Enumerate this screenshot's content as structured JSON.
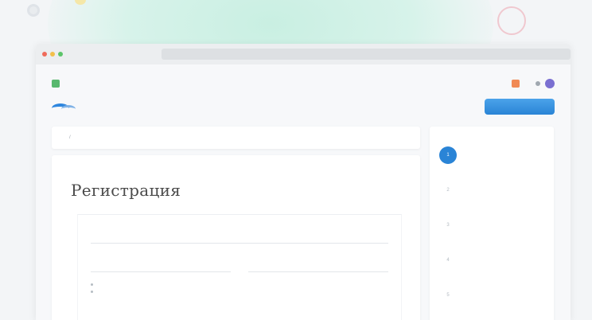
{
  "colors": {
    "accent": "#2a84d6",
    "mint": "#c9efe2",
    "active_step": "#2a84d6"
  },
  "browser": {
    "url": ""
  },
  "topstrip": {
    "left_text": "",
    "right_text": ""
  },
  "header": {
    "brand": "",
    "nav": [
      "",
      "",
      ""
    ],
    "search_placeholder": "",
    "cta_label": ""
  },
  "breadcrumb": [
    "",
    ""
  ],
  "main": {
    "title": "Регистрация",
    "field_email_label": "",
    "field_a_label": "",
    "field_b_label": "",
    "requirements_heading": "",
    "requirements": [
      "",
      ""
    ]
  },
  "steps": {
    "title": "",
    "active_index": 0,
    "items": [
      {
        "num": "1",
        "label": ""
      },
      {
        "num": "2",
        "label": ""
      },
      {
        "num": "3",
        "label": ""
      },
      {
        "num": "4",
        "label": ""
      },
      {
        "num": "5",
        "label": ""
      }
    ]
  }
}
